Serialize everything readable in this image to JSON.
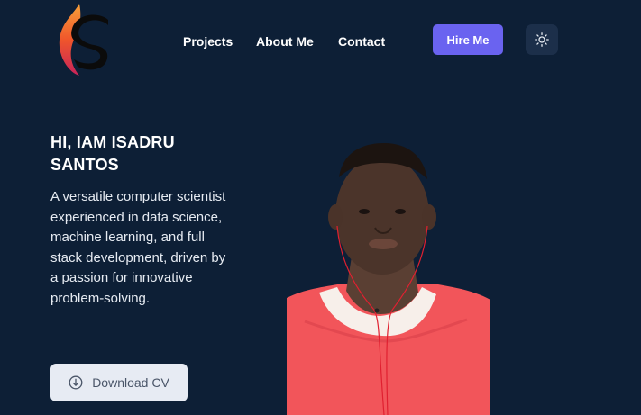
{
  "brand": {
    "logo_name": "logo",
    "accent_flame": "#f0562b"
  },
  "nav": {
    "items": [
      {
        "label": "Projects"
      },
      {
        "label": "About Me"
      },
      {
        "label": "Contact"
      }
    ],
    "hire_label": "Hire Me",
    "theme_icon": "sun-icon"
  },
  "hero": {
    "headline": "HI, IAM ISADRU SANTOS",
    "description": "A versatile computer scientist experienced in data science, machine learning, and full stack development, driven by a passion for innovative problem-solving.",
    "cta_label": "Download CV",
    "cta_icon": "download-icon"
  },
  "colors": {
    "background": "#0d1f36",
    "primary": "#6a63f0",
    "shirt": "#f2555a"
  }
}
